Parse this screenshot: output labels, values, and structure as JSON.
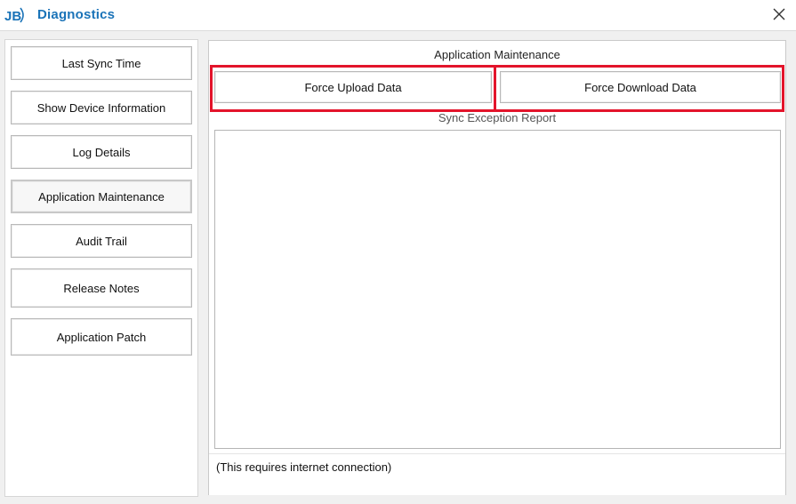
{
  "window": {
    "title": "Diagnostics",
    "logo_text": "JB",
    "accent_color": "#1a73b8",
    "close_icon": "close-icon"
  },
  "sidebar": {
    "items": [
      {
        "label": "Last Sync Time",
        "active": false
      },
      {
        "label": "Show Device Information",
        "active": false
      },
      {
        "label": "Log Details",
        "active": false
      },
      {
        "label": "Application Maintenance",
        "active": true
      },
      {
        "label": "Audit Trail",
        "active": false
      },
      {
        "label": "Release Notes",
        "active": false
      },
      {
        "label": "Application Patch",
        "active": false
      }
    ]
  },
  "main": {
    "section_title": "Application Maintenance",
    "force_upload_label": "Force Upload Data",
    "force_download_label": "Force Download Data",
    "highlight_color": "#e3142b",
    "report_label": "Sync Exception Report",
    "report_content": "",
    "footer_note": "(This requires internet connection)"
  }
}
